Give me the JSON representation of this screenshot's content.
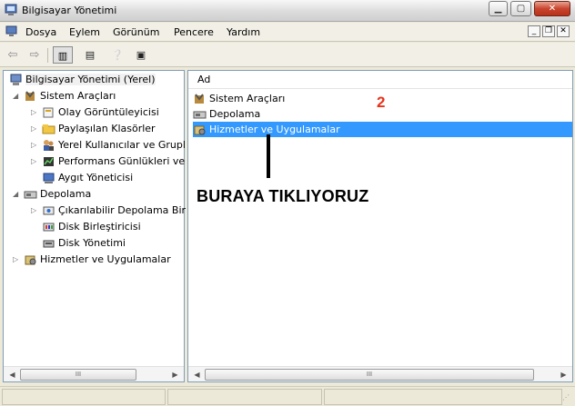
{
  "window": {
    "title": "Bilgisayar Yönetimi"
  },
  "menu": {
    "items": [
      "Dosya",
      "Eylem",
      "Görünüm",
      "Pencere",
      "Yardım"
    ]
  },
  "tree": {
    "root": "Bilgisayar Yönetimi (Yerel)",
    "system_tools": "Sistem Araçları",
    "event_viewer": "Olay Görüntüleyicisi",
    "shared_folders": "Paylaşılan Klasörler",
    "local_users": "Yerel Kullanıcılar ve Grupl",
    "performance_logs": "Performans Günlükleri ve",
    "device_manager": "Aygıt Yöneticisi",
    "storage": "Depolama",
    "removable_storage": "Çıkarılabilir Depolama Bir",
    "defragmenter": "Disk Birleştiricisi",
    "disk_management": "Disk Yönetimi",
    "services_apps": "Hizmetler ve Uygulamalar"
  },
  "list": {
    "column_header": "Ad",
    "items": [
      "Sistem Araçları",
      "Depolama",
      "Hizmetler ve Uygulamalar"
    ],
    "selected_index": 2
  },
  "annotation": {
    "number": "2",
    "text": "BURAYA TIKLIYORUZ"
  },
  "scroll": {
    "thumb_grip": "III"
  },
  "colors": {
    "selection": "#3399ff",
    "annotation_number": "#e8321a"
  }
}
